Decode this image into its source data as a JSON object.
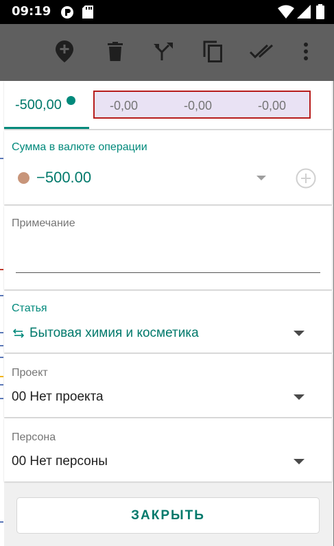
{
  "status_bar": {
    "time": "09:19"
  },
  "toolbar": {
    "icons": [
      "add-location-icon",
      "delete-icon",
      "split-icon",
      "copy-icon",
      "done-all-icon",
      "more-vert-icon"
    ]
  },
  "tabs": {
    "active_amount": "-500,00",
    "other_amounts": [
      "-0,00",
      "-0,00",
      "-0,00"
    ]
  },
  "amount_section": {
    "label": "Сумма в валюте операции",
    "value": "−500.00",
    "colors": {
      "accent": "#00897b",
      "currency_dot": "#c8957a"
    }
  },
  "note_section": {
    "label": "Примечание",
    "value": ""
  },
  "category_section": {
    "label": "Статья",
    "value": "Бытовая химия и косметика",
    "icon": "transfer-arrows-icon"
  },
  "project_section": {
    "label": "Проект",
    "value": "00 Нет проекта"
  },
  "person_section": {
    "label": "Персона",
    "value": "00 Нет персоны"
  },
  "actions": {
    "close_label": "ЗАКРЫТЬ"
  }
}
